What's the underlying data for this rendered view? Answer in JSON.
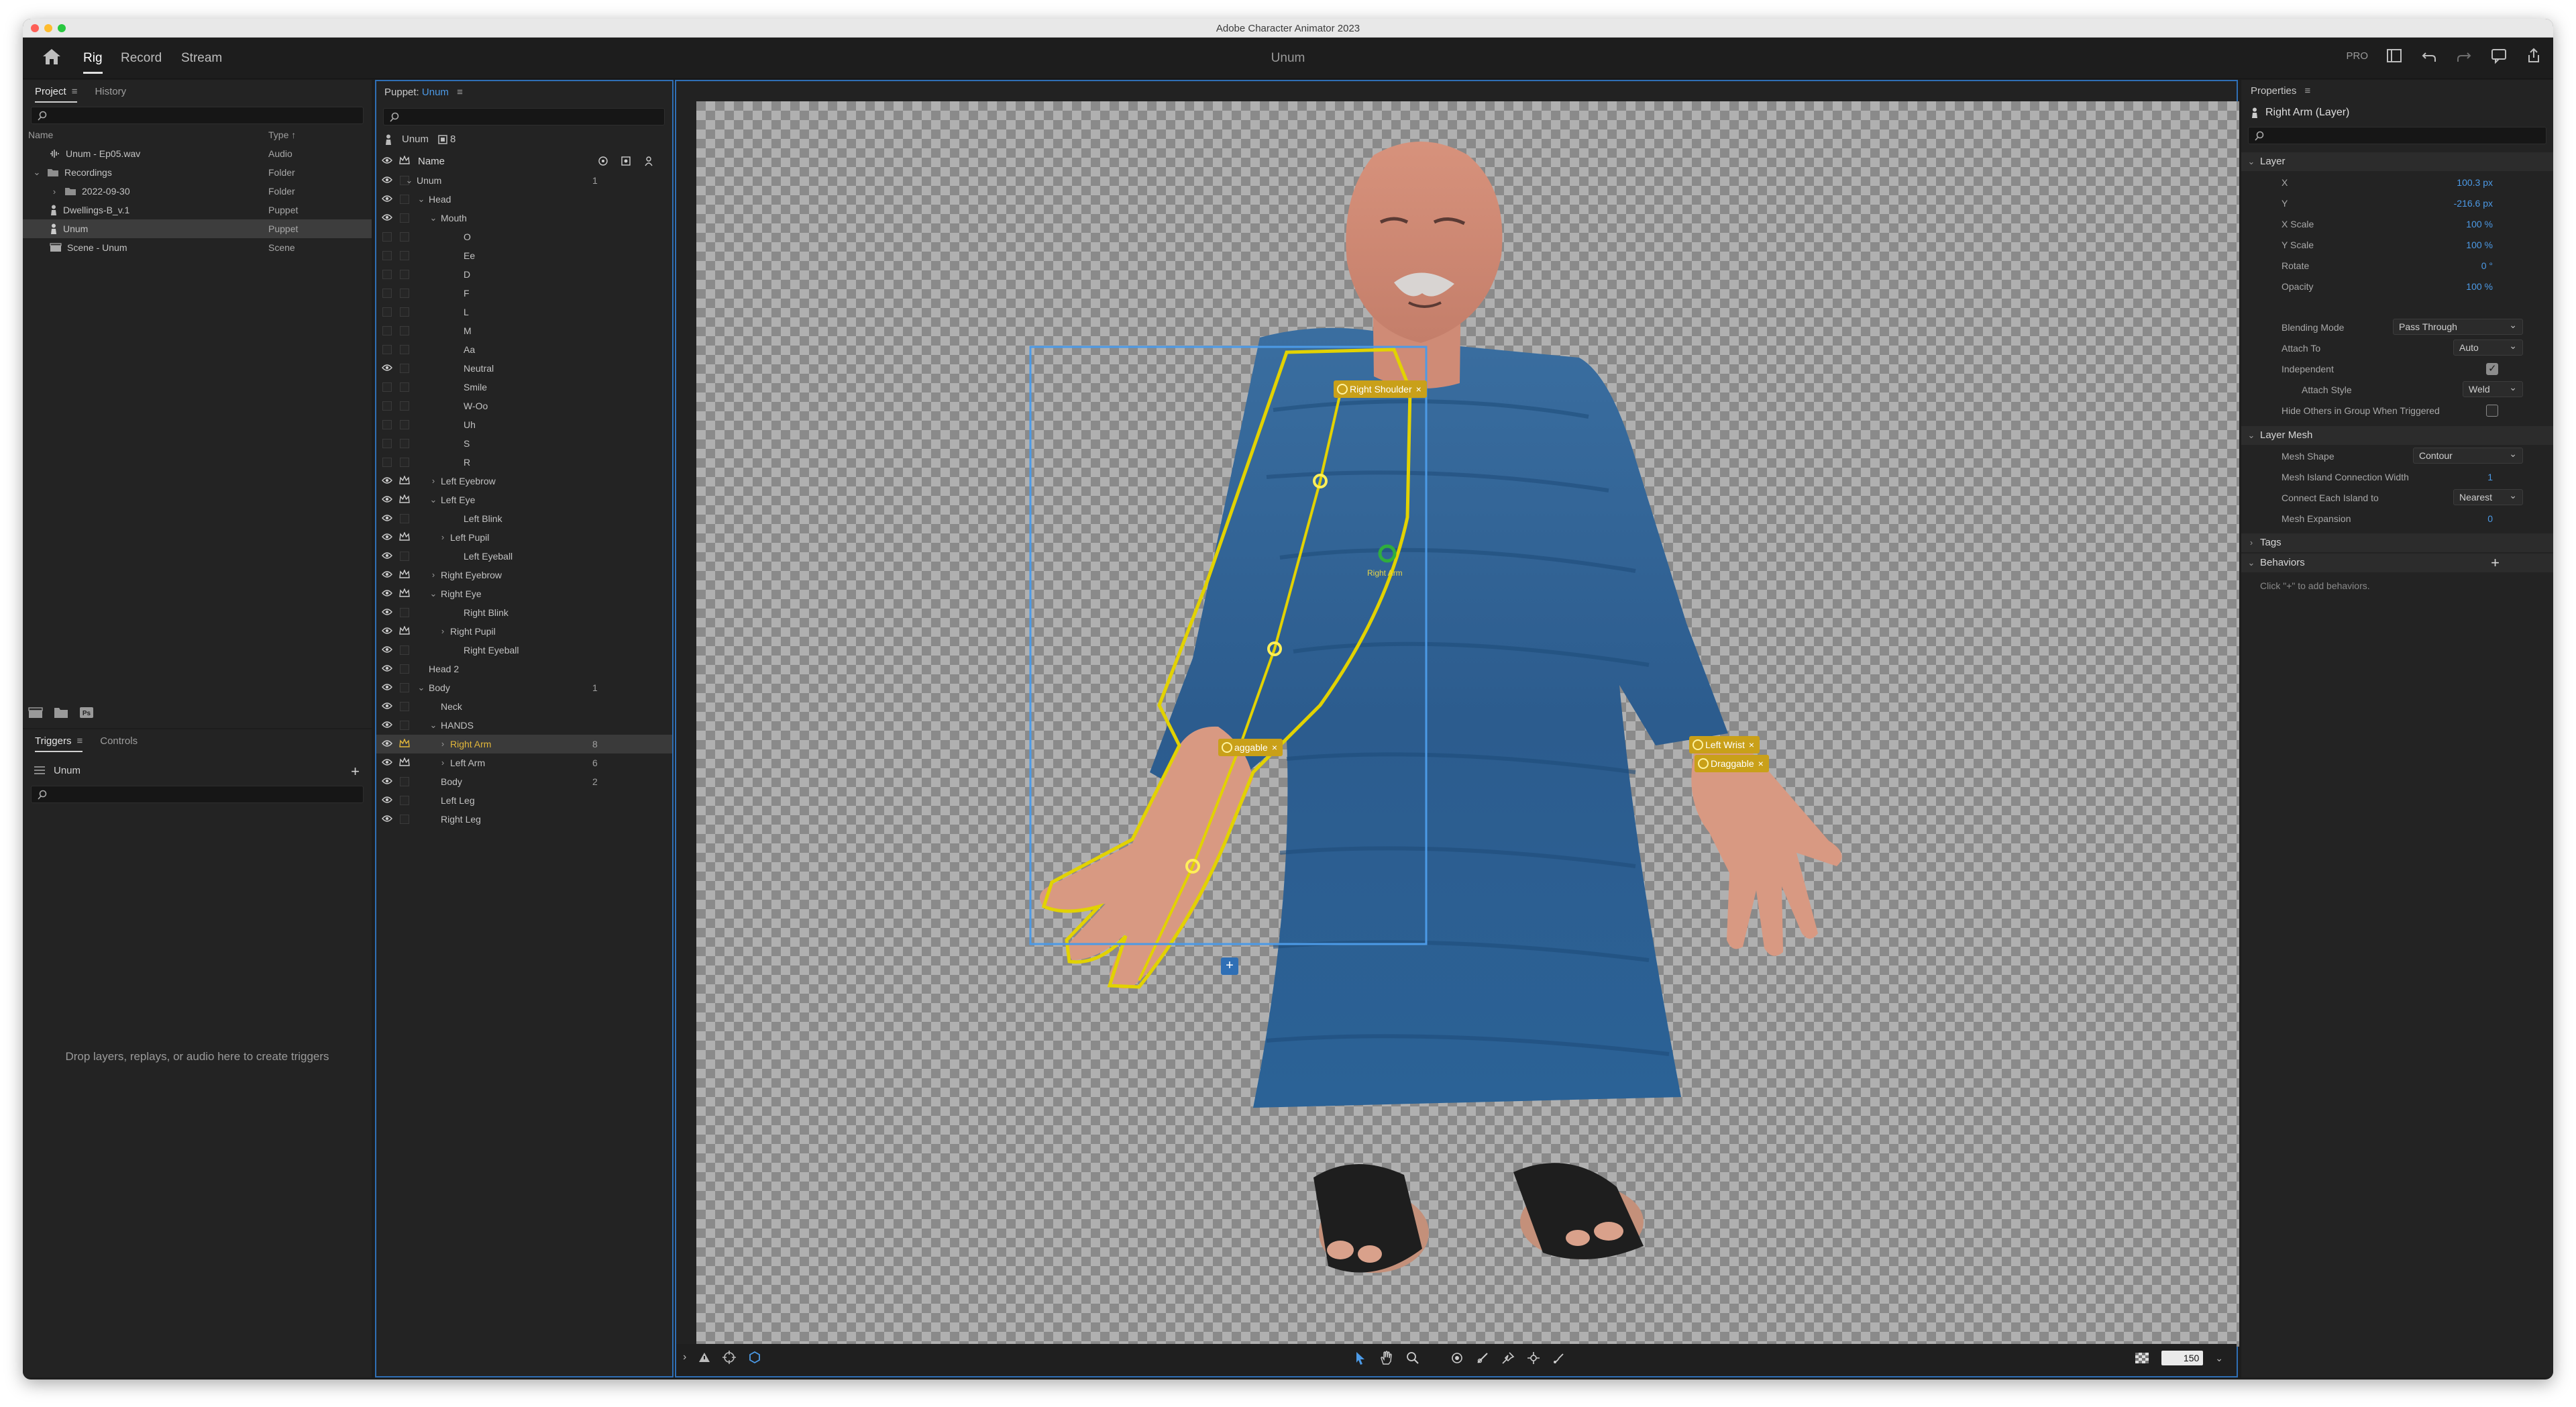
{
  "window": {
    "title": "Adobe Character Animator 2023"
  },
  "appbar": {
    "tabs": [
      "Rig",
      "Record",
      "Stream"
    ],
    "active_tab": "Rig",
    "scene_name": "Unum",
    "pro_label": "PRO"
  },
  "project": {
    "tabs": [
      "Project",
      "History"
    ],
    "columns": {
      "name": "Name",
      "type": "Type"
    },
    "items": [
      {
        "name": "Unum - Ep05.wav",
        "type": "Audio",
        "icon": "audio-icon"
      },
      {
        "name": "Recordings",
        "type": "Folder",
        "icon": "folder-icon"
      },
      {
        "name": "2022-09-30",
        "type": "Folder",
        "icon": "folder-icon"
      },
      {
        "name": "Dwellings-B_v.1",
        "type": "Puppet",
        "icon": "puppet-icon"
      },
      {
        "name": "Unum",
        "type": "Puppet",
        "icon": "puppet-icon"
      },
      {
        "name": "Scene - Unum",
        "type": "Scene",
        "icon": "scene-icon"
      }
    ],
    "bottom_icons": [
      "new-scene-icon",
      "new-folder-icon",
      "photoshop-icon"
    ]
  },
  "triggers": {
    "tabs": [
      "Triggers",
      "Controls"
    ],
    "row_label": "Unum",
    "drop_text": "Drop layers, replays, or audio here to create triggers"
  },
  "puppet": {
    "title_prefix": "Puppet:",
    "title_name": "Unum",
    "crumb_name": "Unum",
    "crumb_count": "8",
    "name_header": "Name",
    "layers": [
      {
        "name": "Unum",
        "num": "1"
      },
      {
        "name": "Head",
        "num": ""
      },
      {
        "name": "Mouth",
        "num": ""
      },
      {
        "name": "O",
        "num": ""
      },
      {
        "name": "Ee",
        "num": ""
      },
      {
        "name": "D",
        "num": ""
      },
      {
        "name": "F",
        "num": ""
      },
      {
        "name": "L",
        "num": ""
      },
      {
        "name": "M",
        "num": ""
      },
      {
        "name": "Aa",
        "num": ""
      },
      {
        "name": "Neutral",
        "num": ""
      },
      {
        "name": "Smile",
        "num": ""
      },
      {
        "name": "W-Oo",
        "num": ""
      },
      {
        "name": "Uh",
        "num": ""
      },
      {
        "name": "S",
        "num": ""
      },
      {
        "name": "R",
        "num": ""
      },
      {
        "name": "Left Eyebrow",
        "num": ""
      },
      {
        "name": "Left Eye",
        "num": ""
      },
      {
        "name": "Left Blink",
        "num": ""
      },
      {
        "name": "Left Pupil",
        "num": ""
      },
      {
        "name": "Left Eyeball",
        "num": ""
      },
      {
        "name": "Right Eyebrow",
        "num": ""
      },
      {
        "name": "Right Eye",
        "num": ""
      },
      {
        "name": "Right Blink",
        "num": ""
      },
      {
        "name": "Right Pupil",
        "num": ""
      },
      {
        "name": "Right Eyeball",
        "num": ""
      },
      {
        "name": "Head 2",
        "num": ""
      },
      {
        "name": "Body",
        "num": "1"
      },
      {
        "name": "Neck",
        "num": ""
      },
      {
        "name": "HANDS",
        "num": ""
      },
      {
        "name": "Right Arm",
        "num": "8"
      },
      {
        "name": "Left Arm",
        "num": "6"
      },
      {
        "name": "Body",
        "num": "2"
      },
      {
        "name": "Left Leg",
        "num": ""
      },
      {
        "name": "Right Leg",
        "num": ""
      }
    ]
  },
  "canvas": {
    "tags": {
      "right_shoulder": "Right Shoulder",
      "draggable_left": "aggable",
      "left_wrist": "Left Wrist",
      "draggable_right": "Draggable",
      "right_arm_label": "Right Arm"
    },
    "zoom": "150"
  },
  "properties": {
    "title": "Properties",
    "layer_title": "Right Arm (Layer)",
    "sections": {
      "layer": "Layer",
      "layer_mesh": "Layer Mesh",
      "tags": "Tags",
      "behaviors": "Behaviors"
    },
    "layer_props": [
      {
        "label": "X",
        "value": "100.3 px"
      },
      {
        "label": "Y",
        "value": "-216.6 px"
      },
      {
        "label": "X Scale",
        "value": "100 %"
      },
      {
        "label": "Y Scale",
        "value": "100 %"
      },
      {
        "label": "Rotate",
        "value": "0 °"
      },
      {
        "label": "Opacity",
        "value": "100 %"
      }
    ],
    "blending_mode": {
      "label": "Blending Mode",
      "value": "Pass Through"
    },
    "attach_to": {
      "label": "Attach To",
      "value": "Auto"
    },
    "independent": {
      "label": "Independent",
      "checked": true
    },
    "attach_style": {
      "label": "Attach Style",
      "value": "Weld"
    },
    "hide_others": {
      "label": "Hide Others in Group When Triggered",
      "checked": false
    },
    "mesh_shape": {
      "label": "Mesh Shape",
      "value": "Contour"
    },
    "mesh_island": {
      "label": "Mesh Island Connection Width",
      "value": "1"
    },
    "connect_island": {
      "label": "Connect Each Island to",
      "value": "Nearest"
    },
    "mesh_expansion": {
      "label": "Mesh Expansion",
      "value": "0"
    },
    "behaviors_hint": "Click \"+\" to add behaviors."
  },
  "colors": {
    "accent_blue": "#4c9ae6",
    "selection_yellow": "#e2d200",
    "tag_gold": "#c9a019",
    "robe_blue": "#2d5f92"
  }
}
